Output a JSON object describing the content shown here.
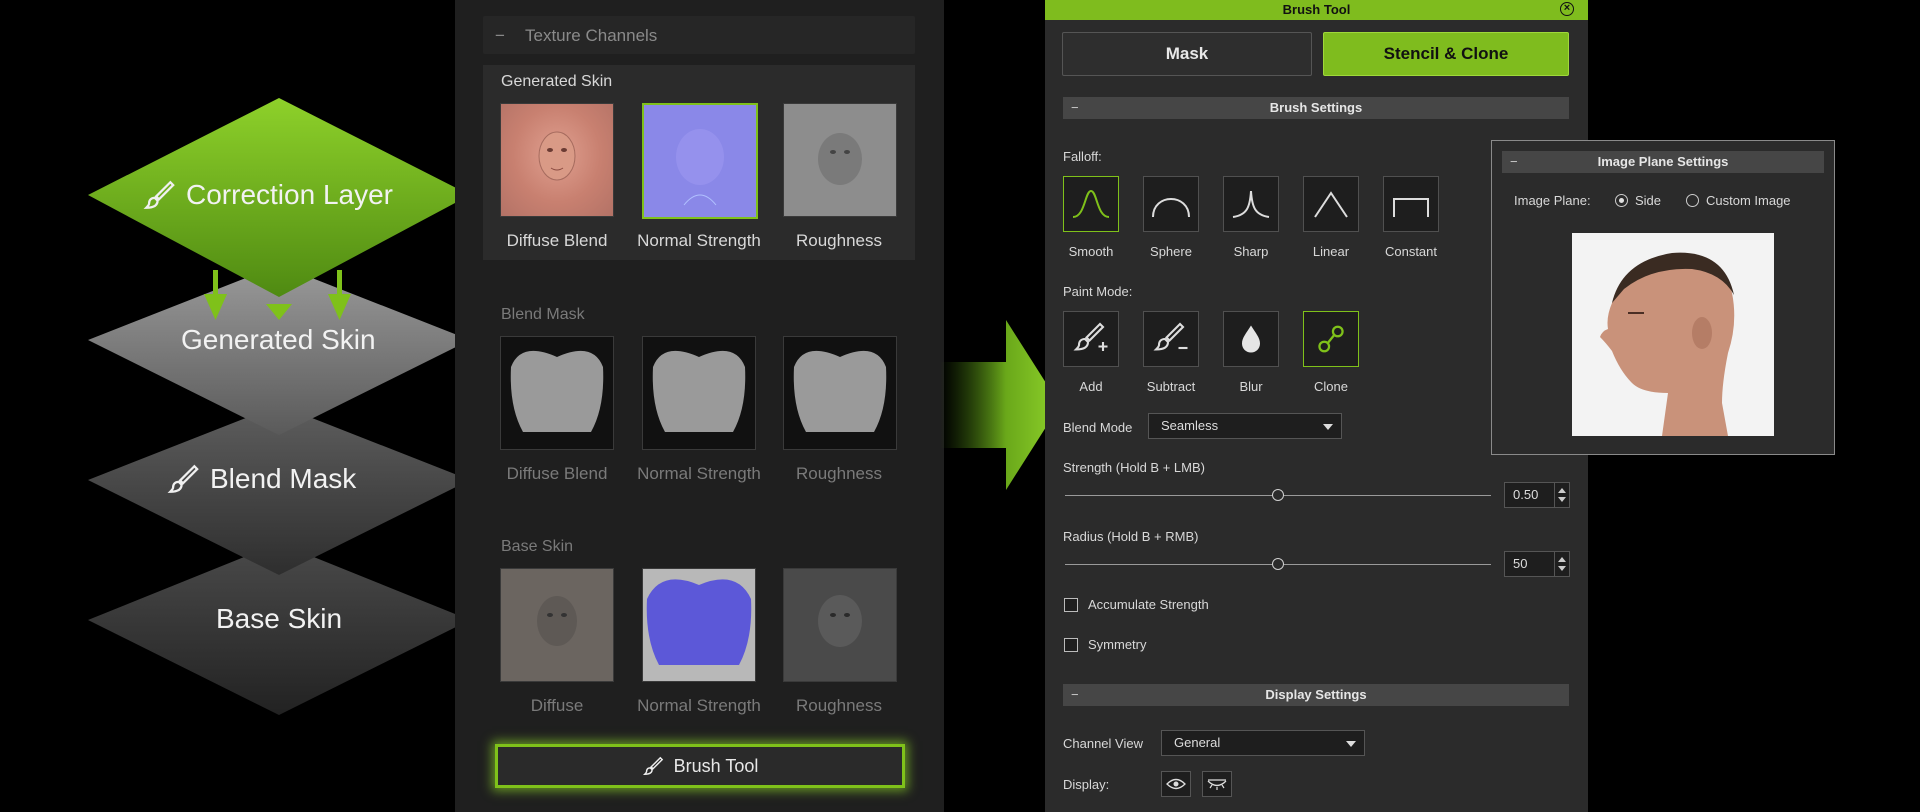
{
  "diagram": {
    "layers": [
      {
        "label": "Correction Layer",
        "icon": "brush-icon"
      },
      {
        "label": "Generated Skin"
      },
      {
        "label": "Blend Mask",
        "icon": "brush-icon"
      },
      {
        "label": "Base Skin"
      }
    ],
    "accent_color": "#7fbc1e"
  },
  "texture_panel": {
    "header_toggle": "−",
    "header": "Texture Channels",
    "groups": [
      {
        "title": "Generated Skin",
        "items": [
          "Diffuse Blend",
          "Normal Strength",
          "Roughness"
        ],
        "selected_index": 1
      },
      {
        "title": "Blend Mask",
        "items": [
          "Diffuse Blend",
          "Normal Strength",
          "Roughness"
        ]
      },
      {
        "title": "Base Skin",
        "items": [
          "Diffuse",
          "Normal Strength",
          "Roughness"
        ]
      }
    ],
    "brush_tool_label": "Brush Tool"
  },
  "brush_panel": {
    "title": "Brush Tool",
    "close_icon": "close-icon",
    "tabs": {
      "mask": "Mask",
      "stencil": "Stencil & Clone",
      "active": "stencil"
    },
    "brush_settings_title": "Brush Settings",
    "falloff_label": "Falloff:",
    "falloff": [
      "Smooth",
      "Sphere",
      "Sharp",
      "Linear",
      "Constant"
    ],
    "falloff_selected": "Smooth",
    "paint_mode_label": "Paint Mode:",
    "paint_modes": [
      "Add",
      "Subtract",
      "Blur",
      "Clone"
    ],
    "paint_mode_selected": "Clone",
    "blend_mode_label": "Blend Mode",
    "blend_mode_value": "Seamless",
    "strength_label": "Strength (Hold B + LMB)",
    "strength_value": "0.50",
    "strength_fraction": 0.5,
    "radius_label": "Radius (Hold B + RMB)",
    "radius_value": "50",
    "radius_fraction": 0.5,
    "accumulate_label": "Accumulate Strength",
    "accumulate_checked": false,
    "symmetry_label": "Symmetry",
    "symmetry_checked": false,
    "display_settings_title": "Display Settings",
    "channel_view_label": "Channel View",
    "channel_view_value": "General",
    "display_label": "Display:",
    "minus": "−"
  },
  "image_plane": {
    "title": "Image Plane Settings",
    "label": "Image Plane:",
    "options": [
      "Side",
      "Custom Image"
    ],
    "selected": "Side"
  }
}
